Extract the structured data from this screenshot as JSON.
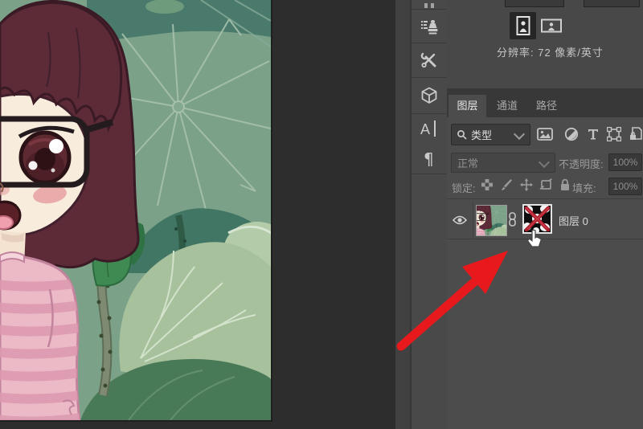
{
  "document_panel": {
    "resolution_text": "分辨率: 72 像素/英寸",
    "orientation": {
      "portrait_selected": true
    }
  },
  "panel_dock": {
    "icons": [
      "clone-source",
      "tool-presets",
      "3d",
      "character",
      "paragraph"
    ]
  },
  "layers_panel": {
    "tabs": [
      {
        "label": "图层",
        "active": true
      },
      {
        "label": "通道",
        "active": false
      },
      {
        "label": "路径",
        "active": false
      }
    ],
    "filter_kind": "类型",
    "blend_mode": "正常",
    "opacity_label": "不透明度:",
    "opacity_value": "100%",
    "lock_label": "锁定:",
    "fill_label": "填充:",
    "fill_value": "100%",
    "layer": {
      "name": "图层 0",
      "visible": true,
      "mask_disabled": true
    }
  },
  "colors": {
    "annotation_arrow": "#e8191d",
    "canvas_leaf": "#7ca189",
    "canvas_teal": "#4a7a6b",
    "panel_bg": "#4c4c4c"
  }
}
